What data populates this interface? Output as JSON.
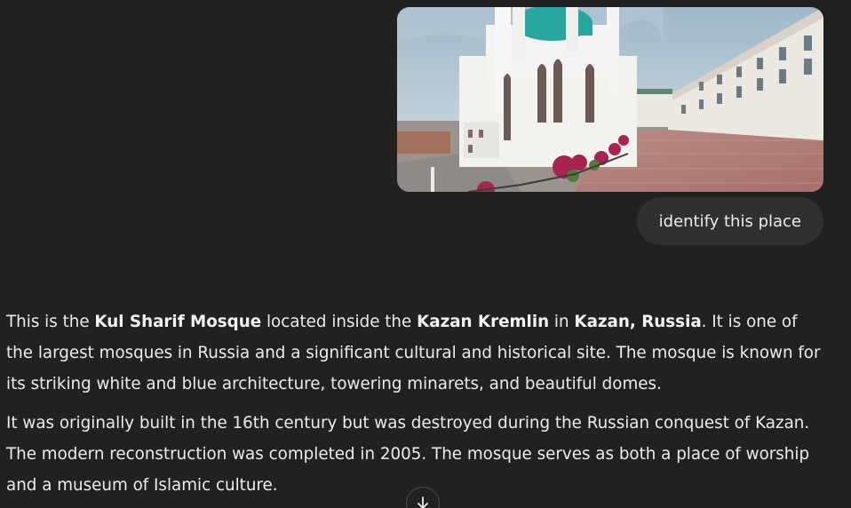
{
  "conversation": {
    "user_message": {
      "text": "identify this place",
      "image_alt": "uploaded photo"
    },
    "assistant_message": {
      "p1": {
        "t1": "This is the ",
        "b1": "Kul Sharif Mosque",
        "t2": " located inside the ",
        "b2": "Kazan Kremlin",
        "t3": " in ",
        "b3": "Kazan, Russia",
        "t4": ". It is one of the largest mosques in Russia and a significant cultural and historical site. The mosque is known for its striking white and blue architecture, towering minarets, and beautiful domes."
      },
      "p2": "It was originally built in the 16th century but was destroyed during the Russian conquest of Kazan. The modern reconstruction was completed in 2005. The mosque serves as both a place of worship and a museum of Islamic culture."
    }
  },
  "controls": {
    "scroll_down_icon": "arrow-down-icon"
  },
  "colors": {
    "background": "#212121",
    "bubble": "#303030",
    "text": "#ececec"
  }
}
